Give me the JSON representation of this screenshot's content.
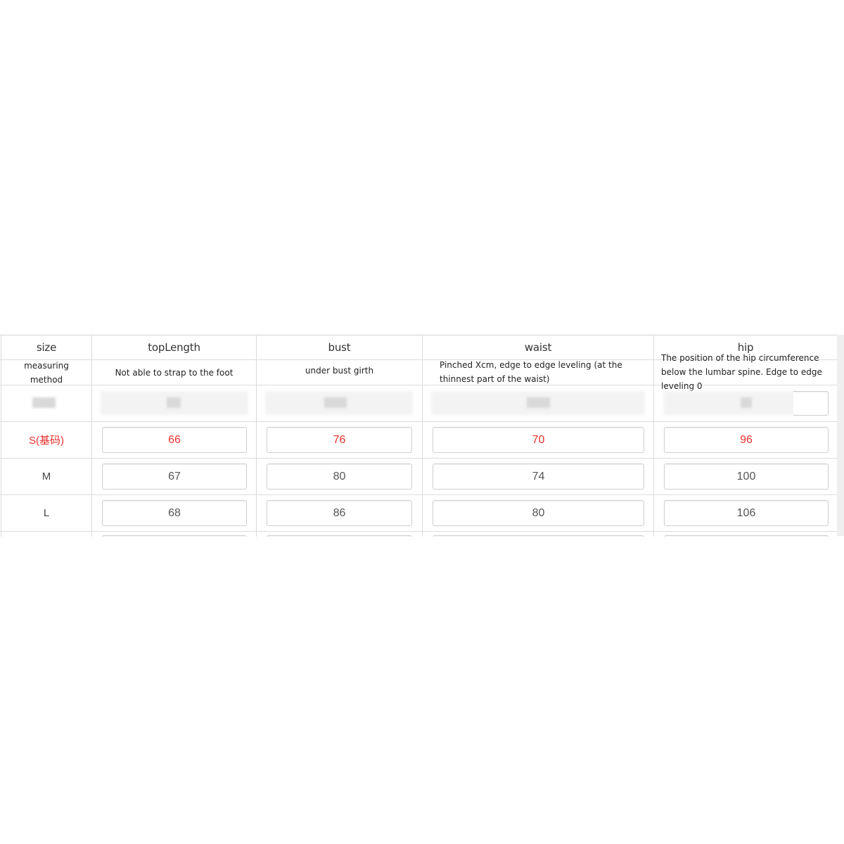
{
  "header": {
    "col_size": "size",
    "col_top_length": "topLength",
    "col_bust": "bust",
    "col_waist": "waist",
    "col_hip": "hip"
  },
  "method": {
    "label": "measuring method",
    "top_length": "Not able to strap to the foot",
    "bust": "under bust girth",
    "waist": "Pinched Xcm, edge to edge leveling (at the thinnest part of the waist)",
    "hip": "The position of the hip circumference below the lumbar spine. Edge to edge leveling 0"
  },
  "rows": [
    {
      "size": "S(基码)",
      "top_length": "66",
      "bust": "76",
      "waist": "70",
      "hip": "96"
    },
    {
      "size": "M",
      "top_length": "67",
      "bust": "80",
      "waist": "74",
      "hip": "100"
    },
    {
      "size": "L",
      "top_length": "68",
      "bust": "86",
      "waist": "80",
      "hip": "106"
    }
  ],
  "colors": {
    "accent": "#e8332f",
    "border": "#dcdcdc",
    "text": "#444444"
  }
}
